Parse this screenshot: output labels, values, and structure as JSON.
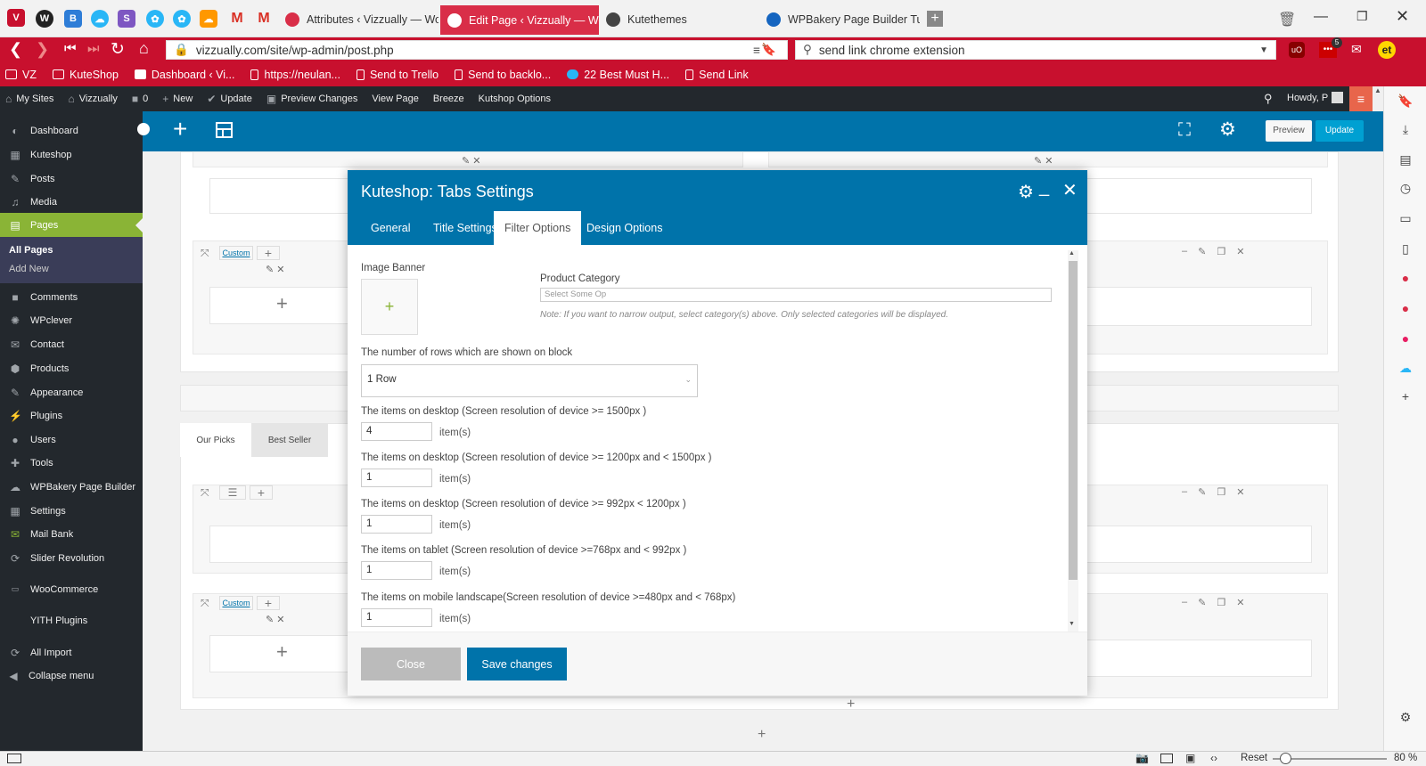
{
  "browser": {
    "tabs": [
      {
        "title": "Attributes ‹ Vizzually — Wor",
        "color": "#d92e48",
        "active": false
      },
      {
        "title": "Edit Page ‹ Vizzually — Word",
        "color": "#fff",
        "active": true
      },
      {
        "title": "Kutethemes",
        "color": "#444",
        "active": false
      },
      {
        "title": "WPBakery Page Builder Tuto",
        "color": "#1565c0",
        "active": false
      }
    ],
    "url": "vizzually.com/site/wp-admin/post.php",
    "search_value": "send link chrome extension",
    "mail_badge": "5",
    "bookmarks": [
      "VZ",
      "KuteShop",
      "Dashboard ‹ Vi...",
      "https://neulan...",
      "Send to Trello",
      "Send to backlo...",
      "22 Best Must H...",
      "Send Link"
    ]
  },
  "adminbar": {
    "items": [
      "My Sites",
      "Vizzually",
      "0",
      "New",
      "Update",
      "Preview Changes",
      "View Page",
      "Breeze",
      "Kutshop Options"
    ],
    "howdy": "Howdy, P"
  },
  "sidebar": {
    "items": [
      "Dashboard",
      "Kuteshop",
      "Posts",
      "Media",
      "Pages",
      "Comments",
      "WPclever",
      "Contact",
      "Products",
      "Appearance",
      "Plugins",
      "Users",
      "Tools",
      "WPBakery Page Builder",
      "Settings",
      "Mail Bank",
      "Slider Revolution",
      "WooCommerce",
      "YITH Plugins",
      "All Import",
      "Collapse menu"
    ],
    "sub_items": [
      "All Pages",
      "Add New"
    ]
  },
  "builder": {
    "preview_label": "Preview",
    "update_label": "Update",
    "custom_label": "Custom",
    "tabs": [
      "Our Picks",
      "Best Seller"
    ]
  },
  "modal": {
    "title": "Kuteshop: Tabs Settings",
    "tabs": [
      "General",
      "Title Settings",
      "Filter Options",
      "Design Options"
    ],
    "image_banner_label": "Image Banner",
    "product_category_label": "Product Category",
    "product_category_placeholder": "Select Some Op",
    "note": "Note: If you want to narrow output, select category(s) above. Only selected categories will be displayed.",
    "rows_label": "The number of rows which are shown on block",
    "rows_value": "1 Row",
    "fields": [
      {
        "label": "The items on desktop (Screen resolution of device >= 1500px )",
        "value": "4"
      },
      {
        "label": "The items on desktop (Screen resolution of device >= 1200px and < 1500px )",
        "value": "1"
      },
      {
        "label": "The items on desktop (Screen resolution of device >= 992px < 1200px )",
        "value": "1"
      },
      {
        "label": "The items on tablet (Screen resolution of device >=768px and < 992px )",
        "value": "1"
      },
      {
        "label": "The items on mobile landscape(Screen resolution of device >=480px and < 768px)",
        "value": "1"
      }
    ],
    "unit": "item(s)",
    "close_label": "Close",
    "save_label": "Save changes"
  },
  "statusbar": {
    "reset_label": "Reset",
    "zoom": "80 %"
  }
}
